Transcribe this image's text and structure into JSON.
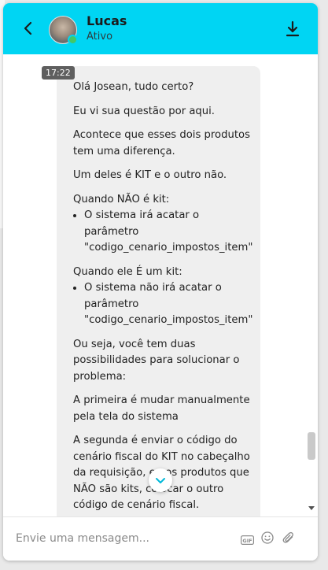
{
  "header": {
    "contact_name": "Lucas",
    "contact_status": "Ativo",
    "back_icon": "chevron-left-icon",
    "download_icon": "download-icon",
    "status_dot_color": "#44c767",
    "accent_color": "#00d5f3"
  },
  "conversation": {
    "timestamp": "17:22",
    "message": {
      "greeting": "Olá Josean, tudo certo?",
      "intro": "Eu vi sua questão por aqui.",
      "difference": "Acontece que esses dois produtos tem uma diferença.",
      "kit_note": "Um deles é KIT e o outro não.",
      "not_kit_heading": "Quando NÃO é kit:",
      "not_kit_item": "O sistema irá acatar o parâmetro \"codigo_cenario_impostos_item\"",
      "kit_heading": "Quando ele É um kit:",
      "kit_item": "O sistema não irá acatar o parâmetro \"codigo_cenario_impostos_item\"",
      "possibilities": "Ou seja, você tem duas possibilidades para solucionar o problema:",
      "first_option": "A primeira é mudar manualmente pela tela do sistema",
      "second_option": "A segunda é enviar o código do cenário fiscal do KIT no cabeçalho da requisição, e nos produtos que NÃO são kits, colocar o outro código de cenário fiscal."
    }
  },
  "composer": {
    "placeholder": "Envie uma mensagem...",
    "gif_label": "GIF",
    "emoji_icon": "smiley-icon",
    "attach_icon": "paperclip-icon"
  }
}
